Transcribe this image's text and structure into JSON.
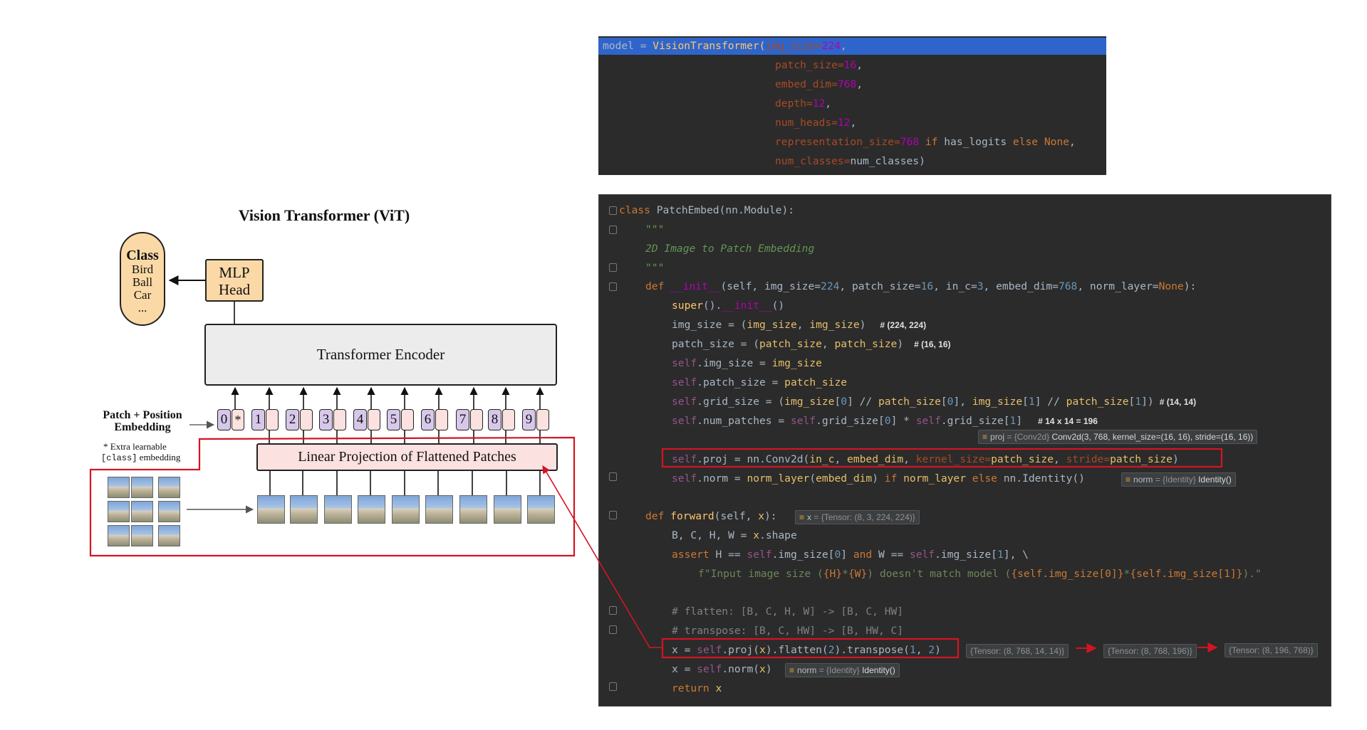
{
  "diagram": {
    "title": "Vision Transformer (ViT)",
    "class_box": {
      "heading": "Class",
      "items": [
        "Bird",
        "Ball",
        "Car",
        "..."
      ]
    },
    "mlp_head": {
      "line1": "MLP",
      "line2": "Head"
    },
    "encoder": "Transformer Encoder",
    "linear_projection": "Linear Projection of Flattened Patches",
    "patch_position_label": {
      "line1": "Patch + Position",
      "line2": "Embedding"
    },
    "extra_note": {
      "line1": "* Extra learnable",
      "code": "[class]",
      "line2": " embedding"
    },
    "tokens": [
      "0",
      "1",
      "2",
      "3",
      "4",
      "5",
      "6",
      "7",
      "8",
      "9"
    ],
    "class_token_mark": "*",
    "highlight_color": "#d41424"
  },
  "code_top": {
    "lines": [
      [
        "model = ",
        "VisionTransformer(",
        "img_size=",
        "224",
        ","
      ],
      [
        "patch_size=",
        "16",
        ","
      ],
      [
        "embed_dim=",
        "768",
        ","
      ],
      [
        "depth=",
        "12",
        ","
      ],
      [
        "num_heads=",
        "12",
        ","
      ],
      [
        "representation_size=",
        "768",
        " if ",
        "has_logits",
        " else ",
        "None",
        ","
      ],
      [
        "num_classes=",
        "num_classes",
        ")"
      ]
    ]
  },
  "code_main": {
    "l1": [
      "class ",
      "PatchEmbed",
      "(nn.Module):"
    ],
    "l2": "\"\"\"",
    "l3": "2D Image to Patch Embedding",
    "l4": "\"\"\"",
    "l5": [
      "def ",
      "__init__",
      "(self, ",
      "img_size=",
      "224",
      ", ",
      "patch_size=",
      "16",
      ", ",
      "in_c=",
      "3",
      ", ",
      "embed_dim=",
      "768",
      ", ",
      "norm_layer=",
      "None",
      "):"
    ],
    "l6": [
      "super",
      "().",
      "__init__",
      "()"
    ],
    "l7": [
      "img_size = (",
      "img_size",
      ", ",
      "img_size",
      ")"
    ],
    "l7c": "# (224, 224)",
    "l8": [
      "patch_size = (",
      "patch_size",
      ", ",
      "patch_size",
      ")"
    ],
    "l8c": "# (16, 16)",
    "l9": [
      "self",
      ".img_size = ",
      "img_size"
    ],
    "l10": [
      "self",
      ".patch_size = ",
      "patch_size"
    ],
    "l11": [
      "self",
      ".grid_size = (",
      "img_size",
      "[",
      "0",
      "] // ",
      "patch_size",
      "[",
      "0",
      "], ",
      "img_size",
      "[",
      "1",
      "] // ",
      "patch_size",
      "[",
      "1",
      "])"
    ],
    "l11c": "# (14, 14)",
    "l12": [
      "self",
      ".num_patches = ",
      "self",
      ".grid_size[",
      "0",
      "] * ",
      "self",
      ".grid_size[",
      "1",
      "]"
    ],
    "l12c": "# 14 x 14 = 196",
    "proj_badge": {
      "name": "proj",
      "type": "= {Conv2d}",
      "value": "Conv2d(3, 768, kernel_size=(16, 16), stride=(16, 16))"
    },
    "l13": [
      "self",
      ".proj = nn.Conv2d(",
      "in_c",
      ", ",
      "embed_dim",
      ", ",
      "kernel_size=",
      "patch_size",
      ", ",
      "stride=",
      "patch_size",
      ")"
    ],
    "l14": [
      "self",
      ".norm = ",
      "norm_layer",
      "(",
      "embed_dim",
      ") ",
      "if ",
      "norm_layer",
      " else ",
      "nn.Identity()"
    ],
    "norm_badge": {
      "name": "norm",
      "type": "= {Identity}",
      "value": "Identity()"
    },
    "l15": [
      "def ",
      "forward",
      "(self, ",
      "x",
      "):"
    ],
    "x_badge": {
      "name": "x",
      "type": "= {Tensor: (8, 3, 224, 224)}"
    },
    "l16": [
      "B, C, H, W = ",
      "x",
      ".shape"
    ],
    "l17": [
      "assert ",
      "H == ",
      "self",
      ".img_size[",
      "0",
      "] ",
      "and ",
      "W == ",
      "self",
      ".img_size[",
      "1",
      "], \\"
    ],
    "l18": [
      "f\"Input image size (",
      "{H}",
      "*",
      "{W}",
      ") doesn't match model (",
      "{self.img_size[0]}",
      "*",
      "{self.img_size[1]}",
      ").\""
    ],
    "l19": "# flatten: [B, C, H, W] -> [B, C, HW]",
    "l20": "# transpose: [B, C, HW] -> [B, HW, C]",
    "l21": [
      "x = ",
      "self",
      ".proj(",
      "x",
      ").flatten(",
      "2",
      ").transpose(",
      "1",
      ", ",
      "2",
      ")"
    ],
    "tensor_shapes": [
      "{Tensor: (8, 768, 14, 14)}",
      "{Tensor: (8, 768, 196)}",
      "{Tensor: (8, 196, 768)}"
    ],
    "l22": [
      "x = ",
      "self",
      ".norm(",
      "x",
      ")"
    ],
    "norm_badge2": {
      "name": "norm",
      "type": "= {Identity}",
      "value": "Identity()"
    },
    "l23": [
      "return ",
      "x"
    ]
  }
}
